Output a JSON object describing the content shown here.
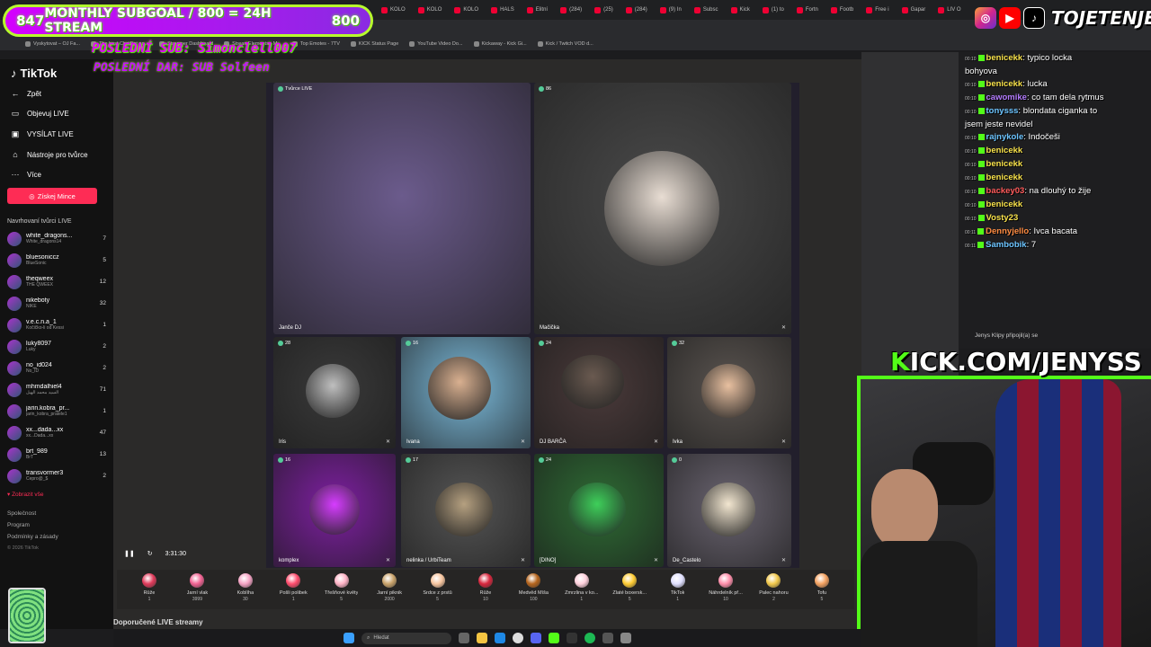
{
  "overlay": {
    "subgoal": {
      "count": "847",
      "title": "MONTHLY SUBGOAL / 800 = 24H STREAM",
      "goal": "800"
    },
    "last_sub": "POSLEDNÍ SUB: Simonclell007",
    "last_sub2": "POSLEDNÍ DAR: SUB Solfeen",
    "handle": "TOJETENJENYS",
    "kick_url": "KICK.COM/JENYSS"
  },
  "browser": {
    "tabs": [
      "KOLO",
      "KOLO",
      "KOLO",
      "HALS",
      "Elitní",
      "(284)",
      "(25)",
      "(284)",
      "(9) In",
      "Subsc",
      "Kick",
      "(1) to",
      "Fortn",
      "Footb",
      "Free i",
      "Gapar",
      "LIV O"
    ],
    "bookmarks": [
      "Vyskytovat – OJ Fa...",
      "The best ChatBot an...",
      "Streamer Dashboard",
      "StreamElements - M...",
      "Top Emotes - 7TV",
      "KICK Status Page",
      "YouTube Video Do...",
      "Kickaway - Kick Gi...",
      "Kick / Twitch VOD d..."
    ]
  },
  "sidebar": {
    "logo": "TikTok",
    "nav": [
      {
        "icon": "arrow-left-icon",
        "label": "Zpět"
      },
      {
        "icon": "monitor-icon",
        "label": "Objevuj LIVE"
      },
      {
        "icon": "video-icon",
        "label": "VYSÍLAT LIVE"
      },
      {
        "icon": "tools-icon",
        "label": "Nástroje pro tvůrce"
      },
      {
        "icon": "more-icon",
        "label": "Více"
      }
    ],
    "coins_button": "Získej Mince",
    "suggested_title": "Navrhovaní tvůrci LIVE",
    "creators": [
      {
        "name": "white_dragons...",
        "sub": "White_dragons14",
        "count": "7"
      },
      {
        "name": "bluesoniccz",
        "sub": "BlueSonic",
        "count": "5"
      },
      {
        "name": "theqweex",
        "sub": "THE QWEEX",
        "count": "12"
      },
      {
        "name": "nikeboty",
        "sub": "NIKE",
        "count": "32"
      },
      {
        "name": "v.e.c.n.a_1",
        "sub": "Kočičko-li od Kessi",
        "count": "1"
      },
      {
        "name": "luky8097",
        "sub": "Luky",
        "count": "2"
      },
      {
        "name": "no_id024",
        "sub": "No_ID",
        "count": "2"
      },
      {
        "name": "mhmdalhiel4",
        "sub": "السيد محمد الهيل",
        "count": "71"
      },
      {
        "name": "jarin.kobra_pr...",
        "sub": "jarin_kobra_pratele1",
        "count": "1"
      },
      {
        "name": "xx...dada...xx",
        "sub": "xx...Dada...xx",
        "count": "47"
      },
      {
        "name": "brt_989",
        "sub": "BrT",
        "count": "13"
      },
      {
        "name": "transvormer3",
        "sub": "Cepro@_$",
        "count": "2"
      }
    ],
    "show_all": "Zobrazit vše",
    "footer": [
      "Společnost",
      "Program",
      "Podmínky a zásady"
    ],
    "copyright": "© 2026 TikTok"
  },
  "stream": {
    "tiles": [
      {
        "label": "Janče DJ",
        "viewers": "Tvůrce LIVE",
        "color": "#6b5b8c"
      },
      {
        "label": "Mačička",
        "viewers": "86",
        "color": "#4a4a4a"
      },
      {
        "label": "Iris",
        "viewers": "28",
        "color": "#3a3a3a"
      },
      {
        "label": "Ivana",
        "viewers": "16",
        "color": "#7ab8d8"
      },
      {
        "label": "DJ BARČA",
        "viewers": "24",
        "color": "#4a3a3a"
      },
      {
        "label": "Ivka",
        "viewers": "32",
        "color": "#5a5450"
      },
      {
        "label": "komplex",
        "viewers": "16",
        "color": "#7d1fa0"
      },
      {
        "label": "nelinka / UrbiTeam",
        "viewers": "17",
        "color": "#555555"
      },
      {
        "label": "[DINO]",
        "viewers": "24",
        "color": "#2e6b34"
      },
      {
        "label": "De_Castelo",
        "viewers": "0",
        "color": "#6a6470"
      }
    ],
    "time": "3:31:30",
    "recommended": "Doporučené LIVE streamy"
  },
  "gifts": [
    {
      "name": "Růže",
      "price": "1",
      "color": "#e03a5a"
    },
    {
      "name": "Jarní vlak",
      "price": "3999",
      "color": "#f06292"
    },
    {
      "name": "Koblíha",
      "price": "30",
      "color": "#f4a3c4"
    },
    {
      "name": "Pošli polibek",
      "price": "1",
      "color": "#ff4d6d"
    },
    {
      "name": "Třešňové květy",
      "price": "5",
      "color": "#ffb3c6"
    },
    {
      "name": "Jarní piknik",
      "price": "2000",
      "color": "#c9a36b"
    },
    {
      "name": "Srdce z prstů",
      "price": "5",
      "color": "#f7c59f"
    },
    {
      "name": "Růže",
      "price": "10",
      "color": "#d7263d"
    },
    {
      "name": "Medvěd Míša",
      "price": "100",
      "color": "#b5651d"
    },
    {
      "name": "Zmrzlina v ko...",
      "price": "1",
      "color": "#ffd1dc"
    },
    {
      "name": "Zlaté boxersk...",
      "price": "5",
      "color": "#ffcc33"
    },
    {
      "name": "TikTok",
      "price": "1",
      "color": "#e0e0ff"
    },
    {
      "name": "Náhrdelník př...",
      "price": "10",
      "color": "#ff8fab"
    },
    {
      "name": "Palec nahoru",
      "price": "2",
      "color": "#f2c94c"
    },
    {
      "name": "Tofu",
      "price": "5",
      "color": "#f4a261"
    }
  ],
  "chat": [
    {
      "time": "00:10",
      "user": "benicekk",
      "user_color": "#f7e14a",
      "text": ": typico locka"
    },
    {
      "time": "",
      "user": "",
      "user_color": "#fff",
      "text": "bohyova"
    },
    {
      "time": "00:10",
      "user": "benicekk",
      "user_color": "#f7e14a",
      "text": ": lucka"
    },
    {
      "time": "00:10",
      "user": "cawomike",
      "user_color": "#b47cff",
      "text": ": co tam dela rytmus"
    },
    {
      "time": "00:10",
      "user": "tonysss",
      "user_color": "#6cc4ff",
      "text": ": blondata ciganka to"
    },
    {
      "time": "",
      "user": "",
      "user_color": "#fff",
      "text": "jsem jeste nevidel"
    },
    {
      "time": "00:10",
      "user": "rajnykole",
      "user_color": "#6cc4ff",
      "text": ": Indočeši"
    },
    {
      "time": "00:10",
      "user": "benicekk",
      "user_color": "#f7e14a",
      "text": ""
    },
    {
      "time": "00:10",
      "user": "benicekk",
      "user_color": "#f7e14a",
      "text": ""
    },
    {
      "time": "00:10",
      "user": "benicekk",
      "user_color": "#f7e14a",
      "text": ""
    },
    {
      "time": "00:10",
      "user": "backey03",
      "user_color": "#ff5a5a",
      "text": ": na dlouhý to žije"
    },
    {
      "time": "00:10",
      "user": "benicekk",
      "user_color": "#f7e14a",
      "text": ""
    },
    {
      "time": "00:10",
      "user": "Vosty23",
      "user_color": "#f7e14a",
      "text": ""
    },
    {
      "time": "00:11",
      "user": "Dennyjello",
      "user_color": "#ff8c42",
      "text": ": Ivca bacata"
    },
    {
      "time": "00:11",
      "user": "Sambobik",
      "user_color": "#6cc4ff",
      "text": ": 7"
    }
  ],
  "chat_join": "Jenys Klipy  připojil(a) se",
  "taskbar": {
    "search": "Hledat"
  }
}
